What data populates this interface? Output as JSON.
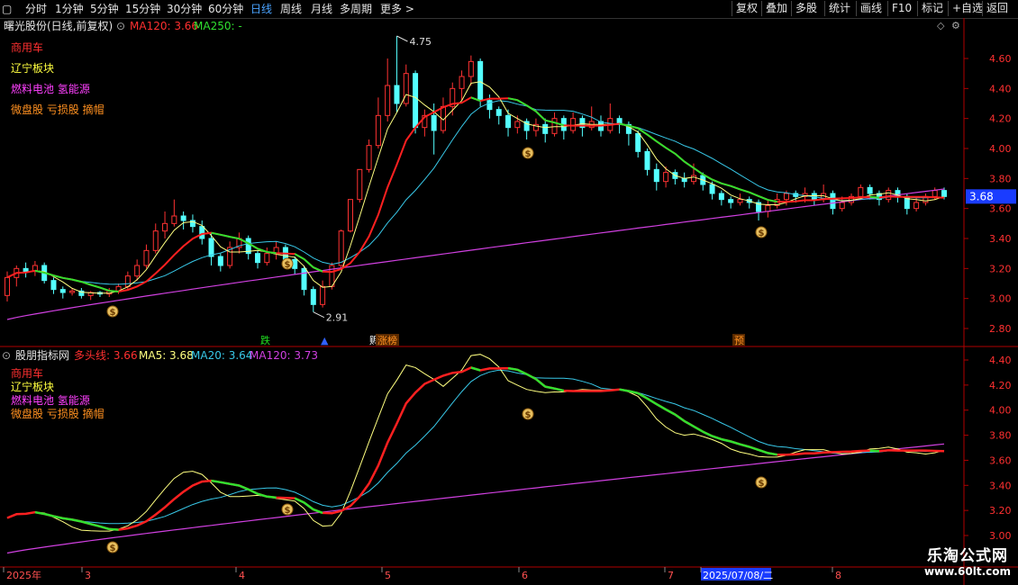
{
  "toolbar": {
    "periods": [
      "分时",
      "1分钟",
      "5分钟",
      "15分钟",
      "30分钟",
      "60分钟",
      "日线",
      "周线",
      "月线",
      "多周期",
      "更多 >"
    ],
    "active_period": "日线",
    "right_buttons": [
      "复权",
      "叠加",
      "多股",
      "统计",
      "画线",
      "F10",
      "标记",
      "+自选",
      "返回"
    ]
  },
  "main_panel": {
    "stock_title": "曙光股份(日线,前复权)",
    "ma120_label": "MA120: 3.66",
    "ma250_label": "MA250: -",
    "tags": [
      {
        "text": "商用车",
        "color": "#ff3030"
      },
      {
        "text": "辽宁板块",
        "color": "#ffff40"
      },
      {
        "text": "燃料电池 氢能源",
        "color": "#ff40ff"
      },
      {
        "text": "微盘股 亏损股 摘帽",
        "color": "#ff9020"
      }
    ],
    "high_label": "4.75",
    "low_label": "2.91",
    "current_price_tag": "3.68",
    "y_ticks": [
      "4.60",
      "4.40",
      "4.20",
      "4.00",
      "3.80",
      "3.60",
      "3.40",
      "3.20",
      "3.00",
      "2.80"
    ],
    "event_markers": [
      "跌",
      "▲",
      "赆",
      "涨榜",
      "预"
    ]
  },
  "indicator_panel": {
    "title": "股朋指标网",
    "line1_label": "多头线: 3.66",
    "line2_label": "MA5: 3.68",
    "line3_label": "MA20: 3.64",
    "line4_label": "MA120: 3.73",
    "tags": [
      {
        "text": "商用车",
        "color": "#ff3030"
      },
      {
        "text": "辽宁板块",
        "color": "#ffff40"
      },
      {
        "text": "燃料电池 氢能源",
        "color": "#ff40ff"
      },
      {
        "text": "微盘股 亏损股 摘帽",
        "color": "#ff9020"
      }
    ],
    "y_ticks": [
      "4.40",
      "4.20",
      "4.00",
      "3.80",
      "3.60",
      "3.40",
      "3.20",
      "3.00"
    ]
  },
  "x_axis": {
    "labels": [
      "2025年",
      "3",
      "4",
      "5",
      "6",
      "7",
      "2025/07/08/二",
      "8"
    ]
  },
  "watermark": {
    "line1": "乐淘公式网",
    "line2": "www.60lt.com"
  },
  "colors": {
    "up": "#ff3232",
    "down": "#54ffff",
    "ma5": "#ffff80",
    "ma10": "#ff2020",
    "ma20": "#38c8e8",
    "ma120": "#d040e0",
    "axis": "#b00000"
  },
  "chart_data": {
    "type": "candlestick",
    "title": "曙光股份(日线,前复权)",
    "ylim": [
      2.75,
      4.75
    ],
    "x_labels": [
      "2025年",
      "3",
      "4",
      "5",
      "6",
      "7",
      "8"
    ],
    "candles": [
      [
        3.02,
        3.14,
        3.18,
        2.98
      ],
      [
        3.14,
        3.2,
        3.22,
        3.08
      ],
      [
        3.2,
        3.18,
        3.24,
        3.14
      ],
      [
        3.18,
        3.22,
        3.25,
        3.15
      ],
      [
        3.22,
        3.12,
        3.24,
        3.1
      ],
      [
        3.12,
        3.06,
        3.14,
        3.03
      ],
      [
        3.06,
        3.04,
        3.08,
        3.0
      ],
      [
        3.04,
        3.05,
        3.07,
        3.02
      ],
      [
        3.05,
        3.02,
        3.07,
        3.0
      ],
      [
        3.02,
        3.04,
        3.05,
        2.99
      ],
      [
        3.04,
        3.03,
        3.05,
        3.01
      ],
      [
        3.03,
        3.05,
        3.07,
        3.01
      ],
      [
        3.05,
        3.08,
        3.1,
        3.03
      ],
      [
        3.08,
        3.15,
        3.18,
        3.06
      ],
      [
        3.15,
        3.22,
        3.26,
        3.12
      ],
      [
        3.22,
        3.32,
        3.36,
        3.2
      ],
      [
        3.32,
        3.45,
        3.5,
        3.3
      ],
      [
        3.45,
        3.5,
        3.58,
        3.4
      ],
      [
        3.5,
        3.55,
        3.66,
        3.48
      ],
      [
        3.55,
        3.52,
        3.58,
        3.46
      ],
      [
        3.52,
        3.48,
        3.56,
        3.44
      ],
      [
        3.48,
        3.4,
        3.52,
        3.36
      ],
      [
        3.4,
        3.28,
        3.44,
        3.22
      ],
      [
        3.28,
        3.22,
        3.3,
        3.18
      ],
      [
        3.22,
        3.34,
        3.38,
        3.2
      ],
      [
        3.34,
        3.4,
        3.44,
        3.3
      ],
      [
        3.4,
        3.3,
        3.42,
        3.26
      ],
      [
        3.3,
        3.24,
        3.32,
        3.2
      ],
      [
        3.24,
        3.3,
        3.34,
        3.22
      ],
      [
        3.3,
        3.34,
        3.38,
        3.26
      ],
      [
        3.34,
        3.26,
        3.36,
        3.22
      ],
      [
        3.26,
        3.2,
        3.28,
        3.16
      ],
      [
        3.2,
        3.06,
        3.22,
        3.02
      ],
      [
        3.06,
        2.96,
        3.08,
        2.91
      ],
      [
        2.96,
        3.08,
        3.12,
        2.94
      ],
      [
        3.08,
        3.22,
        3.24,
        3.06
      ],
      [
        3.22,
        3.45,
        3.46,
        3.2
      ],
      [
        3.45,
        3.66,
        3.66,
        3.44
      ],
      [
        3.66,
        3.86,
        3.86,
        3.64
      ],
      [
        3.86,
        4.02,
        4.06,
        3.84
      ],
      [
        4.02,
        4.22,
        4.34,
        4.0
      ],
      [
        4.22,
        4.42,
        4.6,
        4.18
      ],
      [
        4.42,
        4.3,
        4.75,
        4.24
      ],
      [
        4.3,
        4.5,
        4.56,
        4.28
      ],
      [
        4.5,
        4.14,
        4.52,
        4.1
      ],
      [
        4.14,
        4.22,
        4.26,
        4.08
      ],
      [
        4.22,
        4.12,
        4.3,
        3.96
      ],
      [
        4.12,
        4.28,
        4.34,
        4.1
      ],
      [
        4.28,
        4.4,
        4.44,
        4.22
      ],
      [
        4.4,
        4.48,
        4.52,
        4.32
      ],
      [
        4.48,
        4.58,
        4.62,
        4.42
      ],
      [
        4.58,
        4.32,
        4.6,
        4.28
      ],
      [
        4.32,
        4.26,
        4.36,
        4.2
      ],
      [
        4.26,
        4.22,
        4.28,
        4.16
      ],
      [
        4.22,
        4.14,
        4.26,
        4.08
      ],
      [
        4.14,
        4.18,
        4.22,
        4.1
      ],
      [
        4.18,
        4.12,
        4.2,
        4.06
      ],
      [
        4.12,
        4.16,
        4.2,
        4.08
      ],
      [
        4.16,
        4.1,
        4.2,
        4.04
      ],
      [
        4.1,
        4.2,
        4.24,
        4.08
      ],
      [
        4.2,
        4.12,
        4.22,
        4.06
      ],
      [
        4.12,
        4.2,
        4.24,
        4.1
      ],
      [
        4.2,
        4.14,
        4.22,
        4.08
      ],
      [
        4.14,
        4.18,
        4.28,
        4.12
      ],
      [
        4.18,
        4.12,
        4.22,
        4.08
      ],
      [
        4.12,
        4.2,
        4.3,
        4.1
      ],
      [
        4.2,
        4.16,
        4.22,
        4.1
      ],
      [
        4.16,
        4.1,
        4.18,
        4.02
      ],
      [
        4.1,
        3.98,
        4.12,
        3.94
      ],
      [
        3.98,
        3.86,
        4.0,
        3.82
      ],
      [
        3.86,
        3.78,
        3.9,
        3.72
      ],
      [
        3.78,
        3.84,
        3.88,
        3.74
      ],
      [
        3.84,
        3.8,
        3.86,
        3.76
      ],
      [
        3.8,
        3.78,
        3.84,
        3.74
      ],
      [
        3.78,
        3.82,
        3.9,
        3.76
      ],
      [
        3.82,
        3.76,
        3.84,
        3.72
      ],
      [
        3.76,
        3.7,
        3.78,
        3.66
      ],
      [
        3.7,
        3.66,
        3.72,
        3.62
      ],
      [
        3.66,
        3.64,
        3.68,
        3.6
      ],
      [
        3.64,
        3.66,
        3.7,
        3.62
      ],
      [
        3.66,
        3.64,
        3.68,
        3.6
      ],
      [
        3.64,
        3.58,
        3.66,
        3.52
      ],
      [
        3.58,
        3.62,
        3.66,
        3.54
      ],
      [
        3.62,
        3.66,
        3.7,
        3.6
      ],
      [
        3.66,
        3.7,
        3.72,
        3.62
      ],
      [
        3.7,
        3.68,
        3.72,
        3.64
      ],
      [
        3.68,
        3.7,
        3.74,
        3.64
      ],
      [
        3.7,
        3.66,
        3.72,
        3.62
      ],
      [
        3.66,
        3.7,
        3.76,
        3.64
      ],
      [
        3.7,
        3.6,
        3.72,
        3.56
      ],
      [
        3.6,
        3.64,
        3.68,
        3.58
      ],
      [
        3.64,
        3.68,
        3.7,
        3.62
      ],
      [
        3.68,
        3.74,
        3.76,
        3.66
      ],
      [
        3.74,
        3.7,
        3.76,
        3.66
      ],
      [
        3.7,
        3.66,
        3.72,
        3.62
      ],
      [
        3.66,
        3.72,
        3.74,
        3.64
      ],
      [
        3.72,
        3.68,
        3.74,
        3.64
      ],
      [
        3.68,
        3.6,
        3.7,
        3.56
      ],
      [
        3.6,
        3.64,
        3.68,
        3.58
      ],
      [
        3.64,
        3.68,
        3.7,
        3.62
      ],
      [
        3.68,
        3.72,
        3.74,
        3.66
      ],
      [
        3.72,
        3.68,
        3.74,
        3.66
      ]
    ],
    "ma5_last": 3.68,
    "ma20_last": 3.64,
    "ma120_last": 3.73
  }
}
